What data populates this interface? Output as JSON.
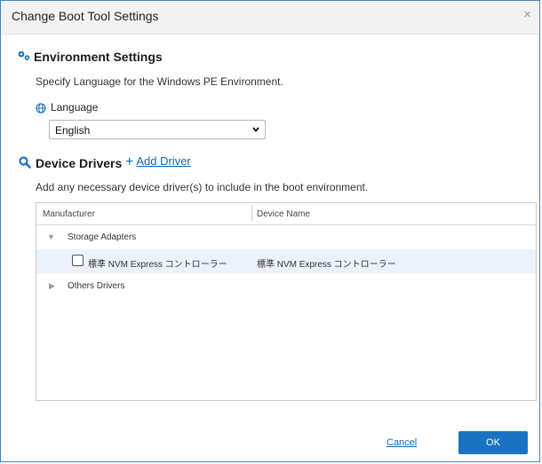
{
  "dialog": {
    "title": "Change Boot Tool Settings",
    "close_symbol": "×"
  },
  "environment": {
    "title": "Environment Settings",
    "description": "Specify Language for the Windows PE Environment.",
    "language_label": "Language",
    "language_value": "English",
    "language_options": [
      "English"
    ]
  },
  "drivers": {
    "title": "Device Drivers",
    "add_plus": "+",
    "add_label": "Add Driver",
    "description": "Add any necessary device driver(s) to include in the boot environment.",
    "columns": [
      "Manufacturer",
      "Device Name"
    ],
    "groups": [
      {
        "label": "Storage Adapters",
        "expanded": true,
        "items": [
          {
            "manufacturer": "標準 NVM Express コントローラー",
            "device": "標準 NVM Express コントローラー",
            "checked": false
          }
        ]
      },
      {
        "label": "Others Drivers",
        "expanded": false
      }
    ]
  },
  "footer": {
    "cancel_label": "Cancel",
    "ok_label": "OK"
  },
  "colors": {
    "accent": "#1a73c2",
    "link": "#0b6ab8",
    "selected_row": "#ecf2fb",
    "frame": "#4a7fc1"
  },
  "icons": {
    "environment": "gears-icon",
    "language": "globe-icon",
    "drivers": "search-icon",
    "expanded": "triangle-down-icon",
    "collapsed": "triangle-right-icon"
  }
}
